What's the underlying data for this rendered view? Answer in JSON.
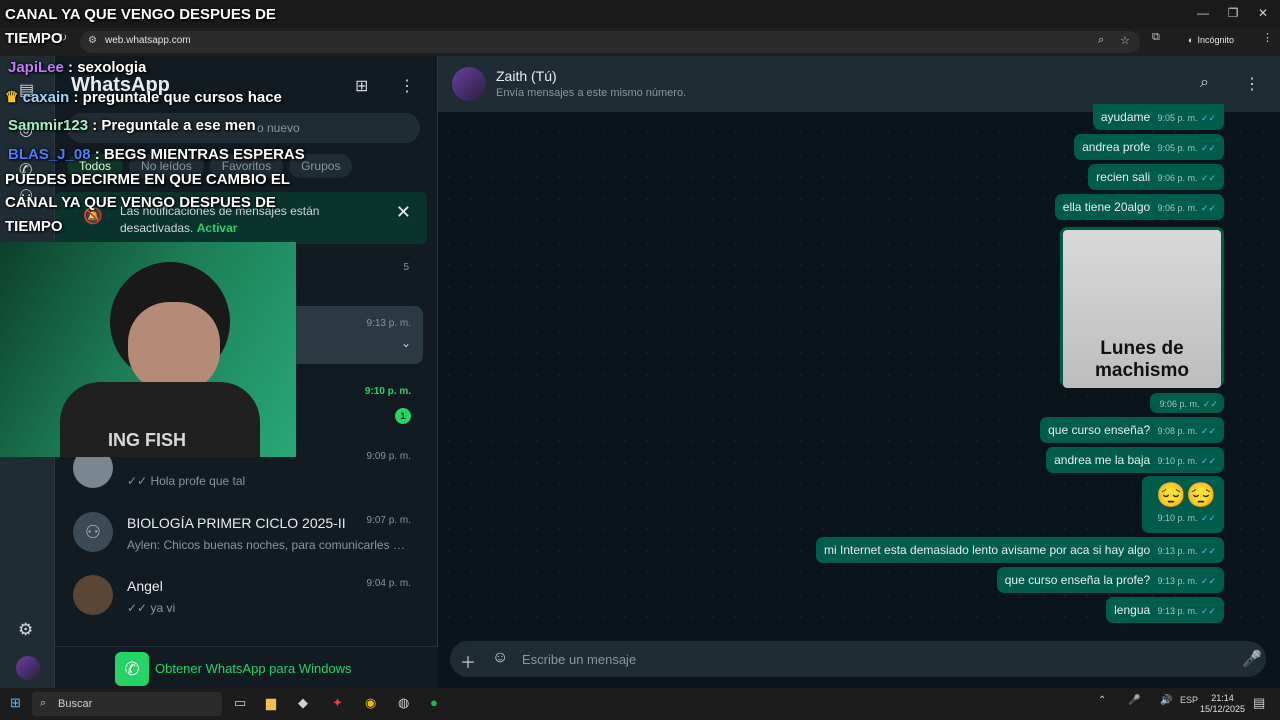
{
  "browser": {
    "url": "web.whatsapp.com",
    "profile_label": "Incógnito"
  },
  "sidebar": {
    "app_title": "WhatsApp",
    "search_placeholder": "Buscar un chat o iniciar uno nuevo",
    "search_visible_fragment": "o nuevo",
    "filters": [
      "Todos",
      "No leídos",
      "Favoritos",
      "Grupos"
    ],
    "notification": {
      "text": "Las notificaciones de mensajes están desactivadas.",
      "link": "Activar"
    },
    "archived_count": "5",
    "chats": [
      {
        "name": "",
        "preview": "",
        "time": "9:13 p. m.",
        "selected": true
      },
      {
        "name": "",
        "preview": "",
        "time": "9:10 p. m.",
        "unread": "1"
      },
      {
        "name": "",
        "preview": "Hola profe que tal",
        "time": "9:09 p. m."
      },
      {
        "name": "BIOLOGÍA PRIMER CICLO 2025-II",
        "preview": "Aylen: Chicos buenas noches, para comunicarles qu...",
        "time": "9:07 p. m."
      },
      {
        "name": "Angel",
        "preview": "ya vi",
        "time": "9:04 p. m."
      }
    ],
    "get_app": "Obtener WhatsApp para Windows"
  },
  "chat": {
    "title": "Zaith (Tú)",
    "subtitle": "Envía mensajes a este mismo número.",
    "messages": [
      {
        "text": "ayudame",
        "time": "9:05 p. m."
      },
      {
        "text": "andrea profe",
        "time": "9:05 p. m."
      },
      {
        "text": "recien sali",
        "time": "9:06 p. m."
      },
      {
        "text": "ella tiene 20algo",
        "time": "9:06 p. m."
      },
      {
        "text": "",
        "time": "9:06 p. m."
      },
      {
        "text": "que curso enseña?",
        "time": "9:08 p. m."
      },
      {
        "text": "andrea me la baja",
        "time": "9:10 p. m."
      },
      {
        "text": "😔😔",
        "time": "9:10 p. m."
      },
      {
        "text": "mi Internet esta demasiado lento avisame por aca si hay algo",
        "time": "9:13 p. m."
      },
      {
        "text": "que curso enseña la profe?",
        "time": "9:13 p. m."
      },
      {
        "text": "lengua",
        "time": "9:13 p. m."
      }
    ],
    "image_caption": "Lunes de\nmachismo",
    "composer_placeholder": "Escribe un mensaje"
  },
  "stream_overlay": {
    "lines": [
      {
        "user": "",
        "text": "CANAL YA QUE VENGO DESPUES DE"
      },
      {
        "user": "",
        "text": "TIEMPO"
      },
      {
        "user": "JapiLee",
        "text": " : sexologia",
        "user_color": "#c07bff"
      },
      {
        "user": "caxain",
        "text": " : preguntale que cursos hace",
        "user_color": "#9ad7ff"
      },
      {
        "user": "Sammir123",
        "text": " : Preguntale a ese men",
        "user_color": "#a6f0c2"
      },
      {
        "user": "BLAS_J_08",
        "text": " : BEGS MIENTRAS ESPERAS",
        "user_color": "#4a7dff"
      },
      {
        "user": "",
        "text": "PUEDES DECIRME EN QUE CAMBIO EL"
      },
      {
        "user": "",
        "text": "CANAL YA QUE VENGO DESPUES DE"
      },
      {
        "user": "",
        "text": "TIEMPO"
      }
    ],
    "shirt_text": "ING FISH"
  },
  "taskbar": {
    "search_label": "Buscar",
    "lang": "ESP",
    "time": "21:14",
    "date": "15/12/2025"
  },
  "colors": {
    "accent": "#25d366",
    "outgoing_bubble": "#005c4b",
    "read_ticks": "#53bdeb"
  }
}
